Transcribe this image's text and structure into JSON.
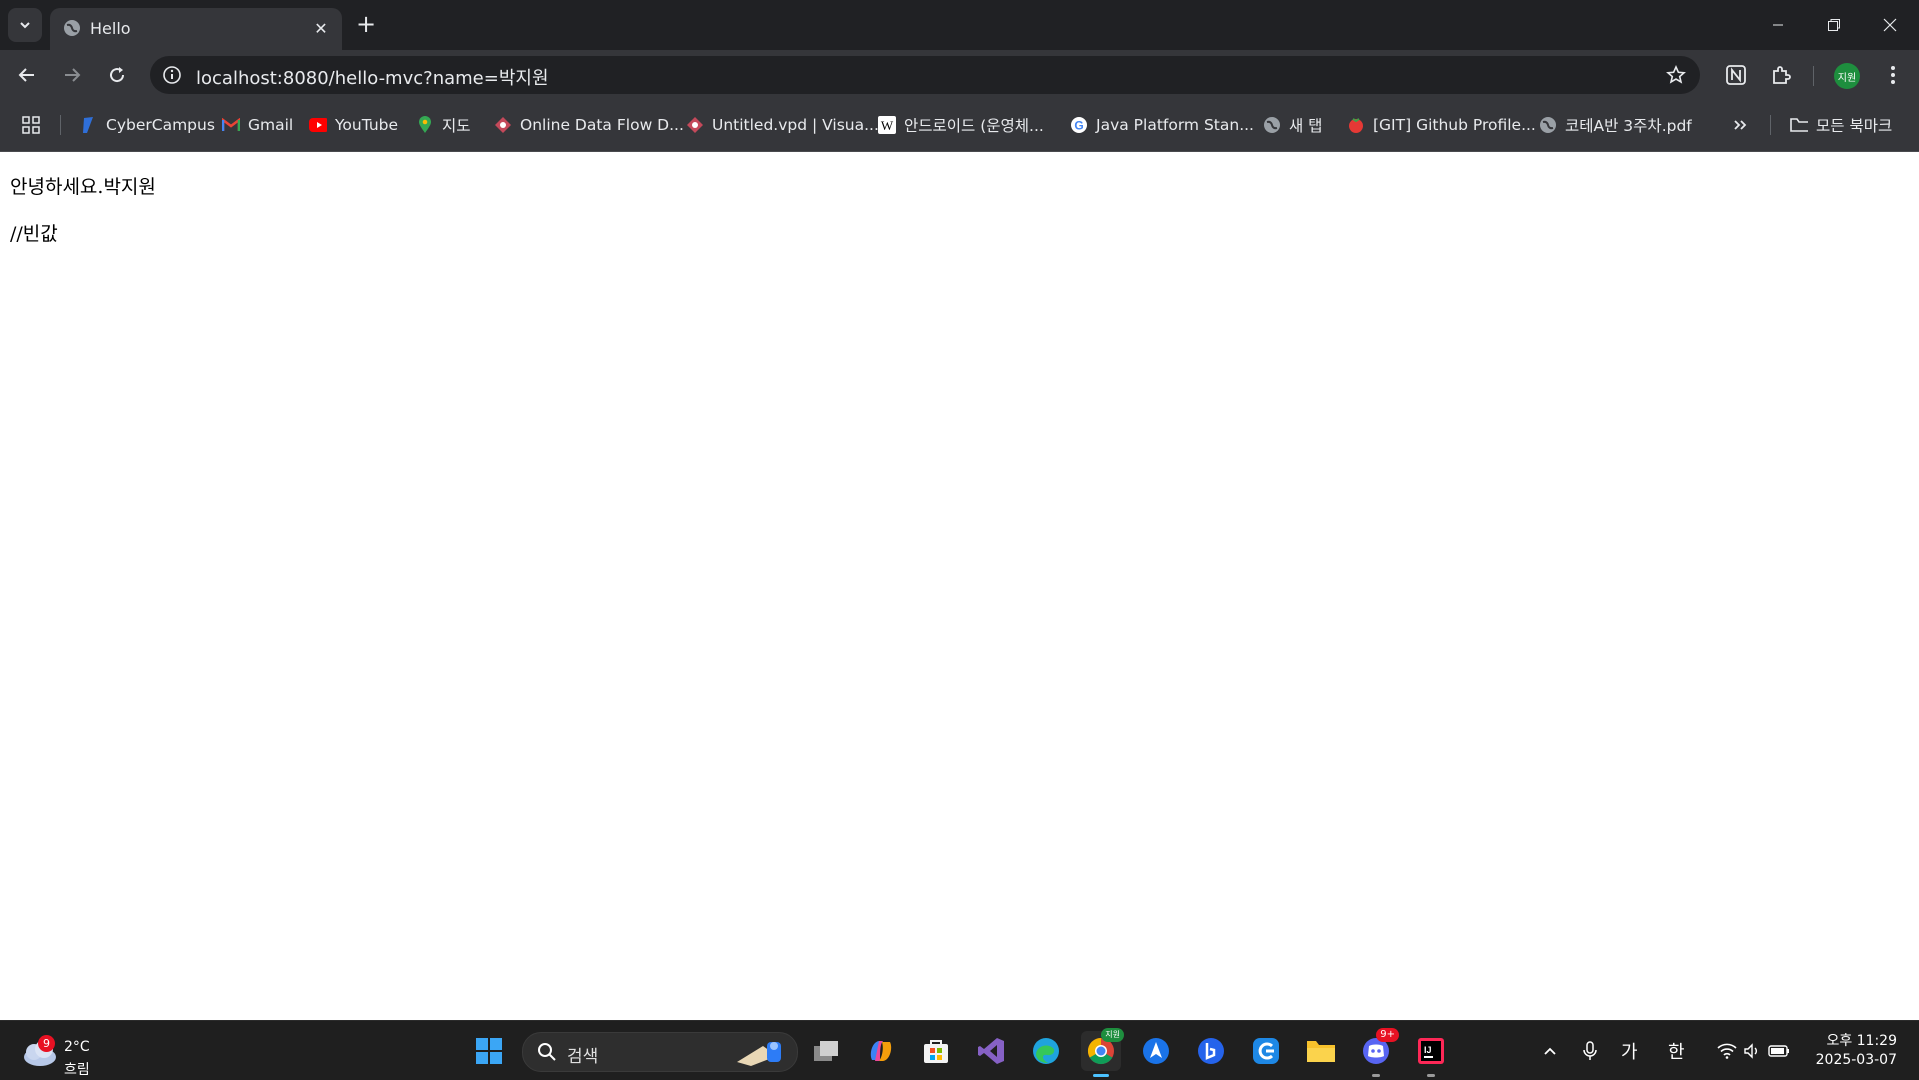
{
  "browser": {
    "tab_title": "Hello",
    "url": "localhost:8080/hello-mvc?name=박지원",
    "profile_label": "지원"
  },
  "bookmarks": [
    {
      "label": "CyberCampus",
      "icon": "cybercampus-icon"
    },
    {
      "label": "Gmail",
      "icon": "gmail-icon"
    },
    {
      "label": "YouTube",
      "icon": "youtube-icon"
    },
    {
      "label": "지도",
      "icon": "maps-icon"
    },
    {
      "label": "Online Data Flow D...",
      "icon": "dataflow-icon"
    },
    {
      "label": "Untitled.vpd | Visua...",
      "icon": "visual-paradigm-icon"
    },
    {
      "label": "안드로이드 (운영체...",
      "icon": "wikipedia-icon"
    },
    {
      "label": "Java Platform Stan...",
      "icon": "google-icon"
    },
    {
      "label": "새 탭",
      "icon": "globe-icon"
    },
    {
      "label": "[GIT] Github Profile...",
      "icon": "tomato-icon"
    },
    {
      "label": "코테A반 3주차.pdf",
      "icon": "globe-icon"
    }
  ],
  "all_bookmarks_label": "모든 북마크",
  "page": {
    "line1": "안녕하세요.박지원",
    "line2": "//빈값"
  },
  "taskbar": {
    "weather_temp": "2°C",
    "weather_cond": "흐림",
    "weather_badge": "9",
    "search_placeholder": "검색",
    "chrome_badge": "지원",
    "discord_badge": "9+",
    "ime_1": "가",
    "ime_2": "한",
    "time": "오후 11:29",
    "date": "2025-03-07"
  }
}
